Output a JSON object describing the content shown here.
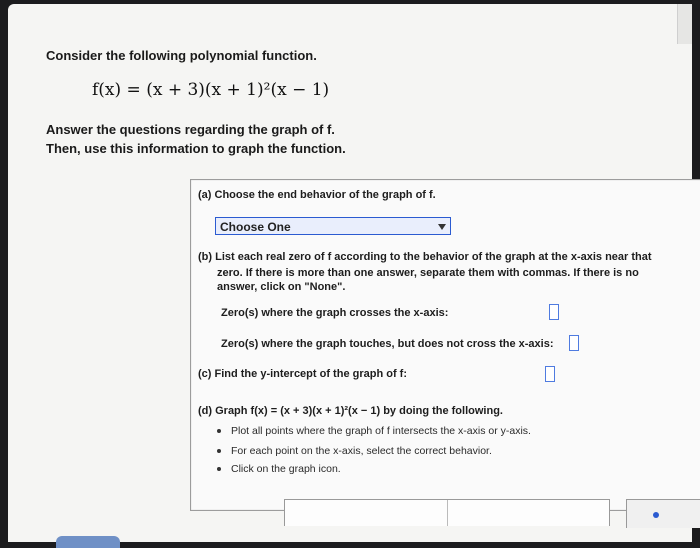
{
  "intro": {
    "line1": "Consider the following polynomial function.",
    "formula": "f(x) = (x + 3)(x + 1)²(x − 1)",
    "line2": "Answer the questions regarding the graph of f.",
    "line3": "Then, use this information to graph the function."
  },
  "part_a": {
    "label": "(a) Choose the end behavior of the graph of f.",
    "select_value": "Choose One"
  },
  "part_b": {
    "label": "(b) List each real zero of f according to the behavior of the graph at the x-axis near that",
    "label2": "zero. If there is more than one answer, separate them with commas. If there is no",
    "label3": "answer, click on \"None\".",
    "crosses": "Zero(s) where the graph crosses the x-axis:",
    "touches": "Zero(s) where the graph touches, but does not cross the x-axis:"
  },
  "part_c": {
    "label": "(c) Find the y-intercept of the graph of f:"
  },
  "part_d": {
    "label": "(d) Graph f(x) = (x + 3)(x + 1)²(x − 1) by doing the following.",
    "bullets": [
      "Plot all points where the graph of f intersects the x-axis or y-axis.",
      "For each point on the x-axis, select the correct behavior.",
      "Click on the graph icon."
    ]
  },
  "colors": {
    "accent": "#2b5bd1",
    "panel_border": "#9c9c9c",
    "background": "#f5f5f3"
  }
}
